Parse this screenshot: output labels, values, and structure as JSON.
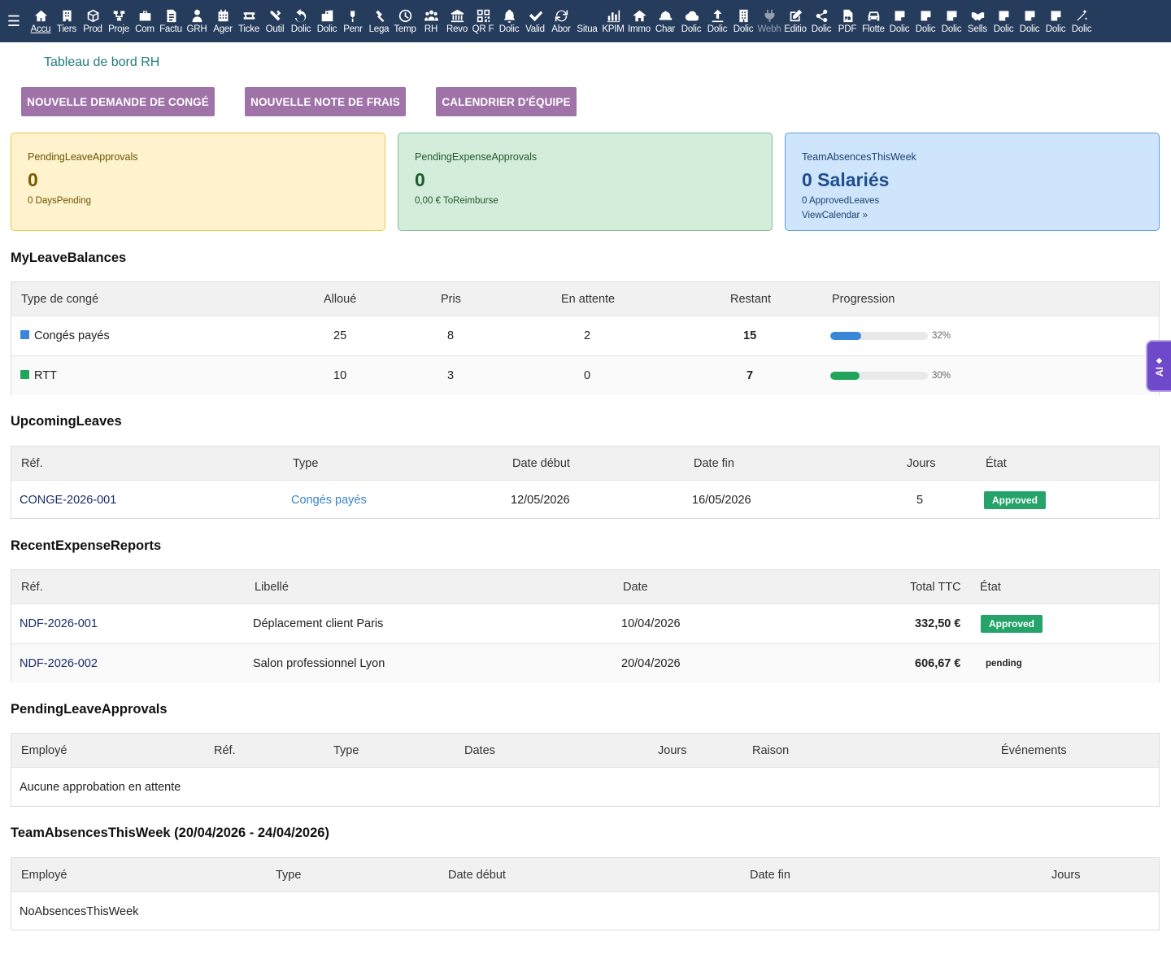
{
  "topbar": {
    "menu_icon": "hamburger-icon",
    "items": [
      {
        "label": "Accu",
        "icon": "home-icon"
      },
      {
        "label": "Tiers",
        "icon": "building-icon"
      },
      {
        "label": "Prod",
        "icon": "cube-icon"
      },
      {
        "label": "Proje",
        "icon": "project-icon"
      },
      {
        "label": "Com",
        "icon": "briefcase-icon"
      },
      {
        "label": "Factu",
        "icon": "invoice-icon"
      },
      {
        "label": "GRH",
        "icon": "user-tie-icon"
      },
      {
        "label": "Ager",
        "icon": "calendar-icon"
      },
      {
        "label": "Ticke",
        "icon": "ticket-icon"
      },
      {
        "label": "Outil",
        "icon": "tools-icon"
      },
      {
        "label": "Dolic",
        "icon": "undo-icon"
      },
      {
        "label": "Dolic",
        "icon": "bag-icon"
      },
      {
        "label": "Penr",
        "icon": "pen-icon"
      },
      {
        "label": "Lega",
        "icon": "gavel-icon"
      },
      {
        "label": "Temp",
        "icon": "clock-icon"
      },
      {
        "label": "RH",
        "icon": "users-icon"
      },
      {
        "label": "Revo",
        "icon": "bank-icon"
      },
      {
        "label": "QR F",
        "icon": "qrcode-icon"
      },
      {
        "label": "Dolic",
        "icon": "bell-icon"
      },
      {
        "label": "Valid",
        "icon": "check-double-icon"
      },
      {
        "label": "Abor",
        "icon": "sync-icon"
      },
      {
        "label": "Situa",
        "icon": "blank-icon"
      },
      {
        "label": "KPIM",
        "icon": "chart-bar-icon"
      },
      {
        "label": "Immo",
        "icon": "house-icon"
      },
      {
        "label": "Char",
        "icon": "hardhat-icon"
      },
      {
        "label": "Dolic",
        "icon": "cloud-icon"
      },
      {
        "label": "Dolic",
        "icon": "upload-icon"
      },
      {
        "label": "Dolic",
        "icon": "office-icon"
      },
      {
        "label": "Webh",
        "icon": "plug-icon"
      },
      {
        "label": "Editio",
        "icon": "edit-icon"
      },
      {
        "label": "Dolic",
        "icon": "share-icon"
      },
      {
        "label": "PDF",
        "icon": "pdf-icon"
      },
      {
        "label": "Flotte",
        "icon": "car-icon"
      },
      {
        "label": "Dolic",
        "icon": "note-icon"
      },
      {
        "label": "Dolic",
        "icon": "note-icon"
      },
      {
        "label": "Dolic",
        "icon": "note-icon"
      },
      {
        "label": "Sells",
        "icon": "handshake-icon"
      },
      {
        "label": "Dolic",
        "icon": "note-icon"
      },
      {
        "label": "Dolic",
        "icon": "note-icon"
      },
      {
        "label": "Dolic",
        "icon": "note-icon"
      },
      {
        "label": "Dolic",
        "icon": "magic-icon"
      }
    ]
  },
  "page": {
    "title": "Tableau de bord RH"
  },
  "actions": {
    "new_leave": "NOUVELLE DEMANDE DE CONGÉ",
    "new_expense": "NOUVELLE NOTE DE FRAIS",
    "team_calendar": "CALENDRIER D'ÉQUIPE"
  },
  "cards": {
    "leave": {
      "title": "PendingLeaveApprovals",
      "value": "0",
      "sub": "0 DaysPending"
    },
    "expense": {
      "title": "PendingExpenseApprovals",
      "value": "0",
      "sub": "0,00 € ToReimburse"
    },
    "absences": {
      "title": "TeamAbsencesThisWeek",
      "value": "0 Salariés",
      "sub": "0 ApprovedLeaves",
      "link": "ViewCalendar »"
    }
  },
  "balances": {
    "title": "MyLeaveBalances",
    "headers": [
      "Type de congé",
      "Alloué",
      "Pris",
      "En attente",
      "Restant",
      "Progression"
    ],
    "rows": [
      {
        "type": "Congés payés",
        "color": "#3a86d8",
        "alloue": "25",
        "pris": "8",
        "attente": "2",
        "restant": "15",
        "progress": 32,
        "progress_label": "32%"
      },
      {
        "type": "RTT",
        "color": "#22a45d",
        "alloue": "10",
        "pris": "3",
        "attente": "0",
        "restant": "7",
        "progress": 30,
        "progress_label": "30%"
      }
    ]
  },
  "upcoming": {
    "title": "UpcomingLeaves",
    "headers": [
      "Réf.",
      "Type",
      "Date début",
      "Date fin",
      "Jours",
      "État"
    ],
    "rows": [
      {
        "ref": "CONGE-2026-001",
        "type": "Congés payés",
        "start": "12/05/2026",
        "end": "16/05/2026",
        "days": "5",
        "state": "Approved"
      }
    ]
  },
  "expenses": {
    "title": "RecentExpenseReports",
    "headers": [
      "Réf.",
      "Libellé",
      "Date",
      "Total TTC",
      "État"
    ],
    "rows": [
      {
        "ref": "NDF-2026-001",
        "label": "Déplacement client Paris",
        "date": "10/04/2026",
        "total": "332,50 €",
        "state": "Approved"
      },
      {
        "ref": "NDF-2026-002",
        "label": "Salon professionnel Lyon",
        "date": "20/04/2026",
        "total": "606,67 €",
        "state": "pending"
      }
    ]
  },
  "approvals": {
    "title": "PendingLeaveApprovals",
    "headers": [
      "Employé",
      "Réf.",
      "Type",
      "Dates",
      "Jours",
      "Raison",
      "Événements"
    ],
    "empty": "Aucune approbation en attente"
  },
  "absences": {
    "title": "TeamAbsencesThisWeek (20/04/2026 - 24/04/2026)",
    "headers": [
      "Employé",
      "Type",
      "Date début",
      "Date fin",
      "Jours"
    ],
    "empty": "NoAbsencesThisWeek"
  },
  "ai_tab": {
    "label": "AI",
    "icon": "sparkle-icon"
  },
  "colors": {
    "topbar": "#263c5c",
    "button": "#a073a8",
    "approved": "#25a36a",
    "title": "#217b7b"
  }
}
